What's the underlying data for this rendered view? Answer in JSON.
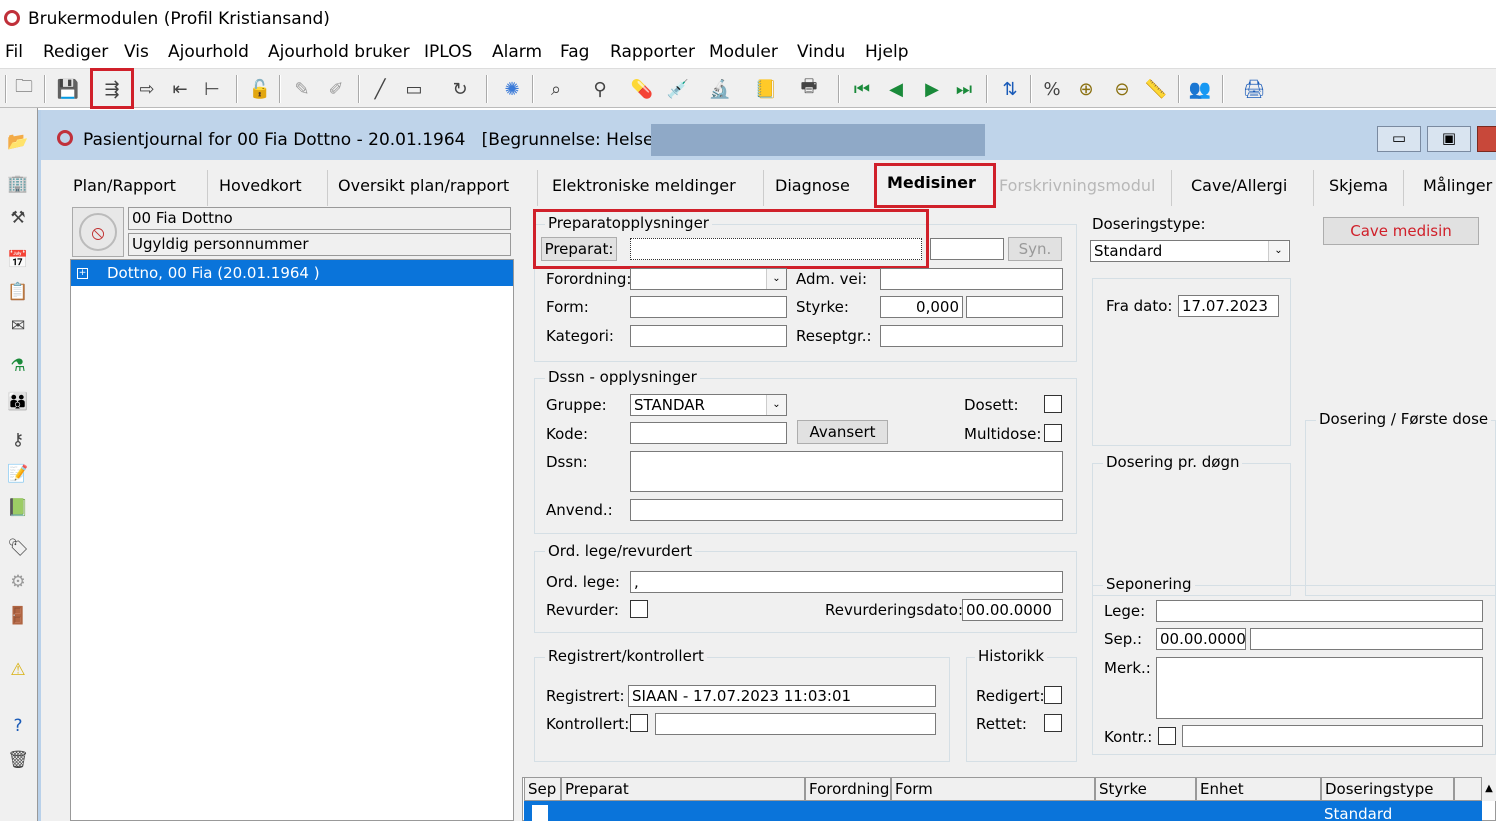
{
  "window_title": "Brukermodulen (Profil Kristiansand)",
  "menu": [
    "Fil",
    "Rediger",
    "Vis",
    "Ajourhold",
    "Ajourhold bruker",
    "IPLOS",
    "Alarm",
    "Fag",
    "Rapporter",
    "Moduler",
    "Vindu",
    "Hjelp"
  ],
  "child_window_title": "Pasientjournal for 00 Fia Dottno - 20.01.1964   [Begrunnelse: Helsehjelp]",
  "tabs": [
    "Plan/Rapport",
    "Hovedkort",
    "Oversikt plan/rapport",
    "Elektroniske meldinger",
    "Diagnose",
    "Medisiner",
    "Forskrivningsmodul",
    "Cave/Allergi",
    "Skjema",
    "Målinger"
  ],
  "active_tab": "Medisiner",
  "patient": {
    "name": "00 Fia Dottno",
    "id_status": "Ugyldig personnummer",
    "tree_item": "Dottno, 00 Fia (20.01.1964 )"
  },
  "preparat": {
    "group_title": "Preparatopplysninger",
    "preparat_button": "Preparat:",
    "preparat_value": "",
    "syn_button": "Syn.",
    "forordning_label": "Forordning:",
    "adm_vei_label": "Adm. vei:",
    "form_label": "Form:",
    "styrke_label": "Styrke:",
    "styrke_value": "0,000",
    "kategori_label": "Kategori:",
    "reseptgr_label": "Reseptgr.:"
  },
  "dosering": {
    "type_label": "Doseringstype:",
    "type_value": "Standard",
    "cave_button": "Cave medisin",
    "fra_dato_label": "Fra dato:",
    "fra_dato_value": "17.07.2023",
    "forste_dose": "Dosering / Første dose",
    "pr_dogn": "Dosering pr. døgn"
  },
  "dssn": {
    "group_title": "Dssn - opplysninger",
    "gruppe_label": "Gruppe:",
    "gruppe_value": "STANDAR",
    "dosett_label": "Dosett:",
    "kode_label": "Kode:",
    "avansert_button": "Avansert",
    "multidose_label": "Multidose:",
    "dssn_label": "Dssn:",
    "anvend_label": "Anvend.:"
  },
  "ord": {
    "group_title": "Ord. lege/revurdert",
    "lege_label": "Ord. lege:",
    "lege_value": ",",
    "revurder_label": "Revurder:",
    "revdato_label": "Revurderingsdato:",
    "revdato_value": "00.00.0000"
  },
  "reg": {
    "group_title": "Registrert/kontrollert",
    "registrert_label": "Registrert:",
    "registrert_value": "SIAAN - 17.07.2023 11:03:01",
    "kontrollert_label": "Kontrollert:"
  },
  "historikk": {
    "group_title": "Historikk",
    "redigert_label": "Redigert:",
    "rettet_label": "Rettet:"
  },
  "seponering": {
    "group_title": "Seponering",
    "lege_label": "Lege:",
    "sep_label": "Sep.:",
    "sep_value": "00.00.0000",
    "merk_label": "Merk.:",
    "kontr_label": "Kontr.:"
  },
  "grid": {
    "headers": [
      "Sep",
      "Preparat",
      "Forordning",
      "Form",
      "Styrke",
      "Enhet",
      "Doseringstype"
    ],
    "row_doseringstype": "Standard"
  }
}
